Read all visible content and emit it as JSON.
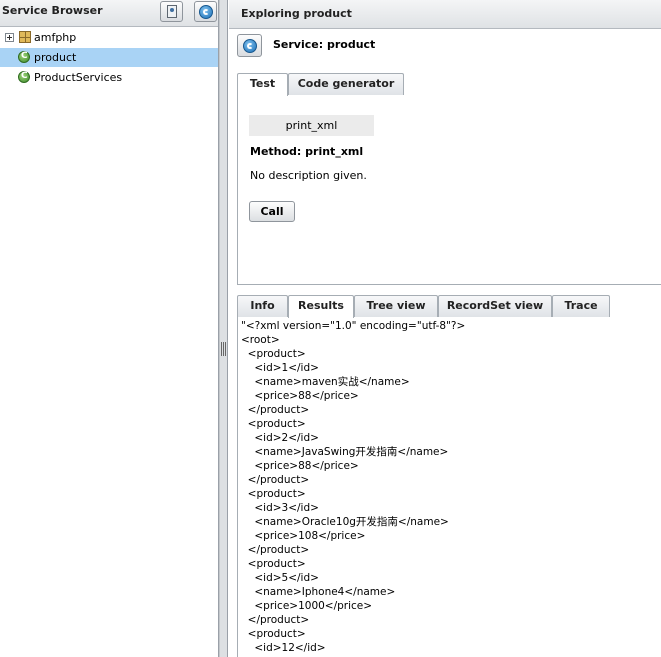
{
  "left_panel": {
    "title": "Service Browser",
    "buttons": [
      {
        "name": "user-button",
        "icon": "person-icon"
      },
      {
        "name": "refresh-button",
        "icon": "refresh-icon"
      }
    ],
    "tree": [
      {
        "label": "amfphp",
        "icon": "package-icon",
        "expandable": true,
        "selected": false
      },
      {
        "label": "product",
        "icon": "service-icon",
        "expandable": false,
        "selected": true
      },
      {
        "label": "ProductServices",
        "icon": "service-icon",
        "expandable": false,
        "selected": false
      }
    ]
  },
  "right_panel": {
    "title": "Exploring product",
    "service_label": "Service: product",
    "top_tabs": [
      {
        "label": "Test",
        "active": true
      },
      {
        "label": "Code generator",
        "active": false
      }
    ],
    "method_name": "print_xml",
    "method_heading": "Method: print_xml",
    "method_description": "No description given.",
    "call_label": "Call",
    "result_tabs": [
      {
        "label": "Info",
        "active": false
      },
      {
        "label": "Results",
        "active": true
      },
      {
        "label": "Tree view",
        "active": false
      },
      {
        "label": "RecordSet view",
        "active": false
      },
      {
        "label": "Trace",
        "active": false
      }
    ],
    "results_lines": [
      "\"<?xml version=\"1.0\" encoding=\"utf-8\"?>",
      "<root>",
      "  <product>",
      "    <id>1</id>",
      "    <name>maven实战</name>",
      "    <price>88</price>",
      "  </product>",
      "  <product>",
      "    <id>2</id>",
      "    <name>JavaSwing开发指南</name>",
      "    <price>88</price>",
      "  </product>",
      "  <product>",
      "    <id>3</id>",
      "    <name>Oracle10g开发指南</name>",
      "    <price>108</price>",
      "  </product>",
      "  <product>",
      "    <id>5</id>",
      "    <name>Iphone4</name>",
      "    <price>1000</price>",
      "  </product>",
      "  <product>",
      "    <id>12</id>"
    ]
  },
  "colors": {
    "selection": "#a9d3f5",
    "header_gradient_top": "#f4f5f6",
    "header_gradient_bottom": "#dfe2e5",
    "method_box": "#ebebeb"
  }
}
